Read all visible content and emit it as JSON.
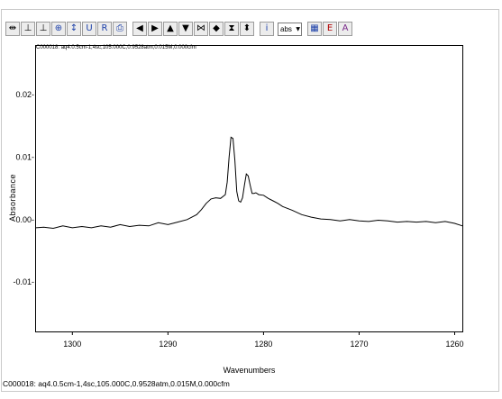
{
  "toolbar": {
    "buttons": [
      {
        "icon": "cursor-arrows-icon",
        "glyph": "⇹"
      },
      {
        "icon": "baseline-icon",
        "glyph": "⊥"
      },
      {
        "icon": "baseline-point-icon",
        "glyph": "⊥"
      },
      {
        "icon": "crosshair-icon",
        "glyph": "⊕"
      },
      {
        "icon": "vertical-arrows-icon",
        "glyph": "↕"
      },
      {
        "icon": "undo-zoom-icon",
        "glyph": "U"
      },
      {
        "icon": "redraw-icon",
        "glyph": "R"
      },
      {
        "icon": "print-icon",
        "glyph": "⎙"
      },
      {
        "icon": "scroll-left-icon",
        "glyph": "◀"
      },
      {
        "icon": "scroll-right-icon",
        "glyph": "▶"
      },
      {
        "icon": "scroll-up-icon",
        "glyph": "▲"
      },
      {
        "icon": "scroll-down-icon",
        "glyph": "▼"
      },
      {
        "icon": "expand-horizontal-icon",
        "glyph": "⋈"
      },
      {
        "icon": "compress-horizontal-icon",
        "glyph": "◆"
      },
      {
        "icon": "expand-vertical-icon",
        "glyph": "⧗"
      },
      {
        "icon": "compress-vertical-icon",
        "glyph": "⬍"
      }
    ],
    "info_glyph": "i",
    "display_mode": "abs",
    "extra_buttons": [
      {
        "icon": "table-icon",
        "glyph": "▦"
      },
      {
        "icon": "spectrum-e-icon",
        "glyph": "E"
      },
      {
        "icon": "spectrum-a-icon",
        "glyph": "A"
      }
    ]
  },
  "plot_header": "C000018: aq4.0.5cm-1,4sc,105.000C,0.9528atm,0.015M,0.000cfm",
  "footer": "C000018: aq4.0.5cm-1,4sc,105.000C,0.9528atm,0.015M,0.000cfm",
  "chart_data": {
    "type": "line",
    "xlabel": "Wavenumbers",
    "ylabel": "Absorbance",
    "x_reversed": true,
    "xlim": [
      1303.8,
      1259.2
    ],
    "ylim": [
      -0.0179,
      0.0278
    ],
    "x_ticks": [
      1300,
      1290,
      1280,
      1270,
      1260
    ],
    "x_tick_labels": [
      "1300",
      "1290",
      "1280",
      "1270",
      "1260"
    ],
    "y_ticks": [
      0.02,
      0.01,
      0.0,
      -0.01
    ],
    "y_tick_labels": [
      "0.02-",
      "0.01-",
      "0.00-",
      "-0.01-"
    ],
    "line_color": "#000000",
    "series": [
      {
        "x": [
          1303.8,
          1303.0,
          1302.0,
          1301.0,
          1300.0,
          1299.0,
          1298.0,
          1297.0,
          1296.0,
          1295.0,
          1294.0,
          1293.0,
          1292.0,
          1291.0,
          1290.0,
          1289.0,
          1288.0,
          1287.0,
          1286.5,
          1286.0,
          1285.5,
          1285.0,
          1284.5,
          1284.0,
          1283.8,
          1283.6,
          1283.4,
          1283.2,
          1283.0,
          1282.8,
          1282.6,
          1282.4,
          1282.2,
          1282.0,
          1281.8,
          1281.6,
          1281.4,
          1281.2,
          1281.0,
          1280.8,
          1280.5,
          1280.0,
          1279.5,
          1279.0,
          1278.5,
          1278.0,
          1277.0,
          1276.0,
          1275.0,
          1274.0,
          1273.0,
          1272.0,
          1271.0,
          1270.0,
          1269.0,
          1268.0,
          1267.0,
          1266.0,
          1265.0,
          1264.0,
          1263.0,
          1262.0,
          1261.0,
          1260.0,
          1259.2
        ],
        "y": [
          -0.0013,
          -0.0012,
          -0.0014,
          -0.001,
          -0.0013,
          -0.0011,
          -0.0013,
          -0.001,
          -0.0012,
          -0.0008,
          -0.0011,
          -0.0009,
          -0.001,
          -0.0005,
          -0.0008,
          -0.0004,
          0.0,
          0.0008,
          0.0016,
          0.0026,
          0.0033,
          0.0035,
          0.0034,
          0.004,
          0.006,
          0.01,
          0.0132,
          0.013,
          0.0095,
          0.0045,
          0.003,
          0.0028,
          0.0035,
          0.0055,
          0.0073,
          0.007,
          0.0055,
          0.0042,
          0.0042,
          0.0043,
          0.004,
          0.0039,
          0.0034,
          0.003,
          0.0026,
          0.0021,
          0.0015,
          0.0008,
          0.0004,
          0.0001,
          0.0,
          -0.0002,
          0.0,
          -0.0002,
          -0.0003,
          -0.0001,
          -0.0002,
          -0.0004,
          -0.0003,
          -0.0004,
          -0.0003,
          -0.0005,
          -0.0003,
          -0.0006,
          -0.001
        ]
      }
    ]
  }
}
